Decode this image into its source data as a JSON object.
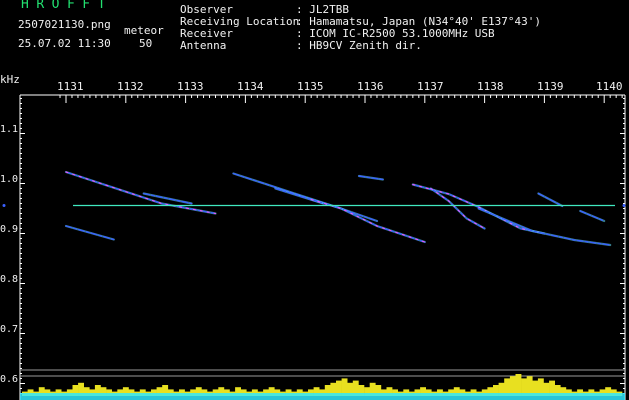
{
  "app": {
    "title": "HROFFT"
  },
  "file": {
    "name": "2507021130.png",
    "datetime": "25.07.02 11:30"
  },
  "mode": {
    "label": "meteor",
    "count": "50"
  },
  "info": [
    {
      "key": "Observer",
      "value": ": JL2TBB"
    },
    {
      "key": "Receiving Location",
      "value": ": Hamamatsu, Japan (N34°40' E137°43')"
    },
    {
      "key": "Receiver",
      "value": ": ICOM IC-R2500 53.1000MHz USB"
    },
    {
      "key": "Antenna",
      "value": ": HB9CV Zenith dir."
    }
  ],
  "colors": {
    "background": "#000000",
    "text": "#f2f2f2",
    "title": "#22e070",
    "axis": "#ffffff",
    "reference_line": "#40e8c0",
    "echo_core": "#ff50ff",
    "echo_mid": "#3a60ff",
    "echo_edge": "#60e0ff",
    "spectrum_fill": "#e8e020",
    "spectrum_base": "#30e8ff"
  },
  "chart_data": {
    "type": "line",
    "x_unit": "minute",
    "y_unit": "kHz",
    "xlim": [
      1130.8,
      1140.1
    ],
    "ylim": [
      0.565,
      1.235
    ],
    "x_ticks": [
      "1131",
      "1132",
      "1133",
      "1134",
      "1135",
      "1136",
      "1137",
      "1138",
      "1139",
      "1140"
    ],
    "y_ticks": [
      "1.1",
      "1.0",
      "0.9",
      "0.8",
      "0.7",
      "0.6"
    ],
    "y_label": "kHz",
    "reference_line_y": 0.951,
    "series": [
      {
        "points": [
          [
            1131.0,
            1.018
          ],
          [
            1132.6,
            0.955
          ],
          [
            1133.5,
            0.935
          ]
        ]
      },
      {
        "points": [
          [
            1131.0,
            0.91
          ],
          [
            1131.8,
            0.883
          ]
        ]
      },
      {
        "points": [
          [
            1132.3,
            0.975
          ],
          [
            1133.1,
            0.955
          ]
        ]
      },
      {
        "points": [
          [
            1133.8,
            1.015
          ],
          [
            1134.8,
            0.976
          ],
          [
            1135.6,
            0.945
          ],
          [
            1136.2,
            0.92
          ]
        ]
      },
      {
        "points": [
          [
            1134.5,
            0.985
          ],
          [
            1135.3,
            0.955
          ]
        ]
      },
      {
        "points": [
          [
            1135.1,
            0.963
          ],
          [
            1135.6,
            0.945
          ],
          [
            1136.2,
            0.91
          ],
          [
            1137.0,
            0.878
          ]
        ]
      },
      {
        "points": [
          [
            1135.9,
            1.01
          ],
          [
            1136.3,
            1.003
          ]
        ]
      },
      {
        "points": [
          [
            1136.8,
            0.993
          ],
          [
            1137.4,
            0.974
          ],
          [
            1137.9,
            0.948
          ],
          [
            1138.6,
            0.905
          ],
          [
            1139.0,
            0.895
          ]
        ]
      },
      {
        "points": [
          [
            1137.1,
            0.985
          ],
          [
            1137.4,
            0.96
          ],
          [
            1137.7,
            0.925
          ],
          [
            1138.0,
            0.905
          ]
        ]
      },
      {
        "points": [
          [
            1137.9,
            0.945
          ],
          [
            1138.8,
            0.9
          ],
          [
            1139.5,
            0.882
          ],
          [
            1140.1,
            0.872
          ]
        ]
      },
      {
        "points": [
          [
            1138.9,
            0.975
          ],
          [
            1139.3,
            0.95
          ]
        ]
      },
      {
        "points": [
          [
            1139.6,
            0.94
          ],
          [
            1140.0,
            0.92
          ]
        ]
      }
    ],
    "spectrum_levels": [
      0.2,
      0.3,
      0.2,
      0.4,
      0.3,
      0.2,
      0.3,
      0.2,
      0.3,
      0.5,
      0.6,
      0.4,
      0.3,
      0.5,
      0.4,
      0.3,
      0.2,
      0.3,
      0.4,
      0.3,
      0.2,
      0.3,
      0.2,
      0.3,
      0.4,
      0.5,
      0.3,
      0.2,
      0.3,
      0.2,
      0.3,
      0.4,
      0.3,
      0.2,
      0.3,
      0.4,
      0.3,
      0.2,
      0.4,
      0.3,
      0.2,
      0.3,
      0.2,
      0.3,
      0.4,
      0.3,
      0.2,
      0.3,
      0.2,
      0.3,
      0.2,
      0.3,
      0.4,
      0.3,
      0.5,
      0.6,
      0.7,
      0.8,
      0.6,
      0.7,
      0.5,
      0.4,
      0.6,
      0.5,
      0.3,
      0.4,
      0.3,
      0.2,
      0.3,
      0.2,
      0.3,
      0.4,
      0.3,
      0.2,
      0.3,
      0.2,
      0.3,
      0.4,
      0.3,
      0.2,
      0.3,
      0.2,
      0.3,
      0.4,
      0.5,
      0.6,
      0.8,
      0.9,
      1.0,
      0.8,
      0.9,
      0.7,
      0.8,
      0.6,
      0.7,
      0.5,
      0.4,
      0.3,
      0.2,
      0.3,
      0.2,
      0.3,
      0.2,
      0.3,
      0.4,
      0.3,
      0.2
    ]
  }
}
